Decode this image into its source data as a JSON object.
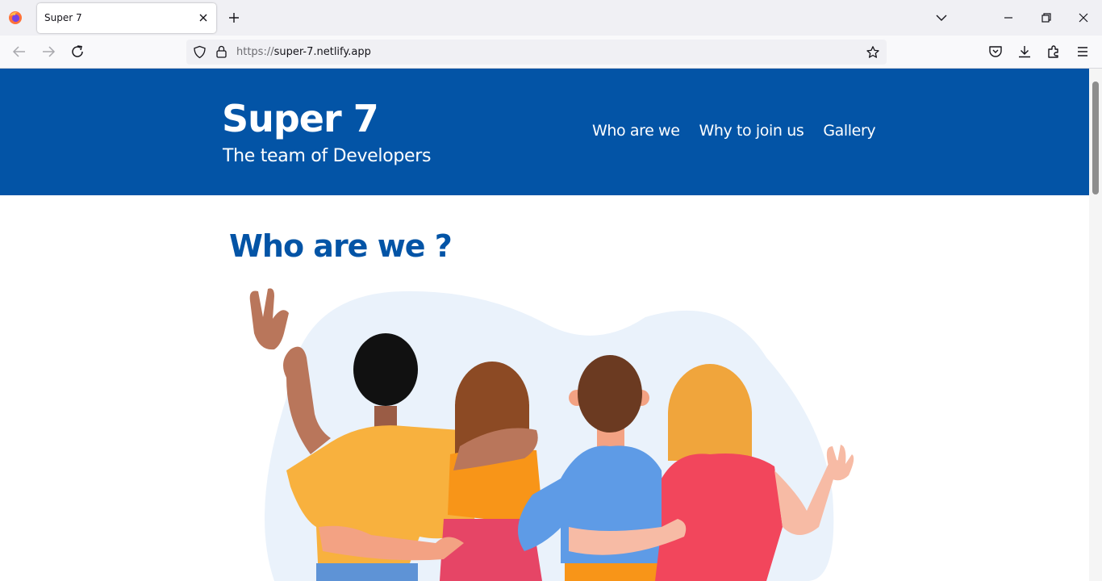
{
  "browser": {
    "tab": {
      "title": "Super 7"
    },
    "url": {
      "scheme": "https://",
      "host": "super-7.netlify.app"
    },
    "icons": {
      "app": "firefox-logo-icon",
      "tab_close": "close-icon",
      "new_tab": "plus-icon",
      "tabs_list": "chevron-down-icon",
      "back": "arrow-left-icon",
      "forward": "arrow-right-icon",
      "reload": "reload-icon",
      "tracking": "shield-icon",
      "security": "lock-icon",
      "bookmark": "star-icon",
      "pocket": "pocket-icon",
      "downloads": "download-icon",
      "extensions": "puzzle-icon",
      "menu": "hamburger-menu-icon"
    }
  },
  "site": {
    "brand": {
      "title": "Super 7",
      "subtitle": "The team of Developers"
    },
    "nav": [
      {
        "label": "Who are we"
      },
      {
        "label": "Why to join us"
      },
      {
        "label": "Gallery"
      }
    ],
    "section": {
      "title": "Who are we ?",
      "illustration": "team-of-friends-hugging-illustration"
    }
  },
  "colors": {
    "brand_blue": "#0354a6",
    "header_text": "#ffffff",
    "blob": "#eaf2fb"
  }
}
